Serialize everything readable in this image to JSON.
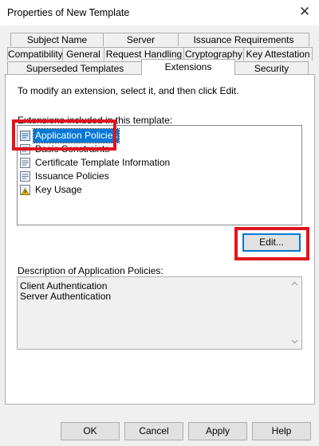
{
  "window": {
    "title": "Properties of New Template",
    "close_label": "✕"
  },
  "tabs_row1": [
    "Subject Name",
    "Server",
    "Issuance Requirements"
  ],
  "tabs_row2": [
    "Compatibility",
    "General",
    "Request Handling",
    "Cryptography",
    "Key Attestation"
  ],
  "tabs_row3": [
    "Superseded Templates",
    "Extensions",
    "Security"
  ],
  "active_tab": "Extensions",
  "panel": {
    "instruction": "To modify an extension, select it, and then click Edit.",
    "list_label": "Extensions included in this template:",
    "extensions": [
      "Application Policies",
      "Basic Constraints",
      "Certificate Template Information",
      "Issuance Policies",
      "Key Usage"
    ],
    "selected_extension": "Application Policies",
    "edit_button": "Edit...",
    "description_label": "Description of Application Policies:",
    "description_lines": [
      "Client Authentication",
      "Server Authentication"
    ]
  },
  "footer": {
    "ok": "OK",
    "cancel": "Cancel",
    "apply": "Apply",
    "help": "Help"
  },
  "colors": {
    "selection": "#0078d7",
    "highlight_box": "#e0141e",
    "dialog_bg": "#f0f0f0"
  },
  "icons": [
    "close-icon",
    "certificate-icon",
    "warning-certificate-icon",
    "scroll-up-icon",
    "scroll-down-icon"
  ]
}
